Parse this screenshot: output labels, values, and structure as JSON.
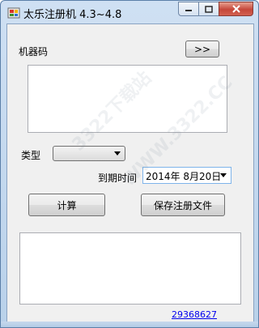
{
  "window": {
    "title": "太乐注册机  4.3~4.8"
  },
  "form": {
    "machine_code_label": "机器码",
    "machine_code_button": ">>",
    "machine_code_value": "",
    "type_label": "类型",
    "type_selected": "",
    "expiry_label": "到期时间",
    "expiry_value": "2014年  8月20日",
    "calculate_button": "计算",
    "save_button": "保存注册文件",
    "output_value": "",
    "link_text": "29368627"
  },
  "watermark": {
    "text_1": "3322下载站",
    "text_2": "WWW.3322.CC"
  },
  "colors": {
    "link": "#0000ee",
    "close_button": "#c5473a",
    "title_bar": "#cfe0f3"
  },
  "icons": [
    "app-icon",
    "minimize-icon",
    "maximize-icon",
    "close-icon",
    "chevron-down-icon"
  ]
}
